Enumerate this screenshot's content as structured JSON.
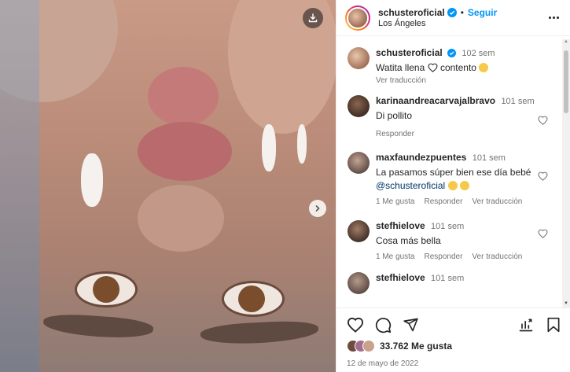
{
  "post": {
    "username": "schusteroficial",
    "follow_label": "Seguir",
    "location": "Los Ángeles",
    "caption": {
      "username": "schusteroficial",
      "time": "102 sem",
      "text_before": "Watita llena",
      "text_after": "contento",
      "translate": "Ver traducción"
    },
    "comments": [
      {
        "username": "karinaandreacarvajalbravo",
        "time": "101 sem",
        "text": "Di pollito",
        "actions": [
          "Responder"
        ]
      },
      {
        "username": "maxfaundezpuentes",
        "time": "101 sem",
        "text": "La pasamos súper bien ese día bebé",
        "mention": "@schusteroficial",
        "actions": [
          "1 Me gusta",
          "Responder",
          "Ver traducción"
        ]
      },
      {
        "username": "stefhielove",
        "time": "101 sem",
        "text": "Cosa más bella",
        "actions": [
          "1 Me gusta",
          "Responder",
          "Ver traducción"
        ]
      },
      {
        "username": "stefhielove",
        "time": "101 sem",
        "text": ""
      }
    ],
    "likes": "33.762 Me gusta",
    "date": "12 de mayo de 2022"
  },
  "colors": {
    "accent": "#0095f6",
    "text": "#262626",
    "muted": "#737373",
    "verified": "#0095f6"
  },
  "icons": [
    "download-icon",
    "chevron-right-icon",
    "verified-badge-icon",
    "more-icon",
    "heart-icon",
    "comment-icon",
    "share-icon",
    "save-icon",
    "chart-icon"
  ]
}
